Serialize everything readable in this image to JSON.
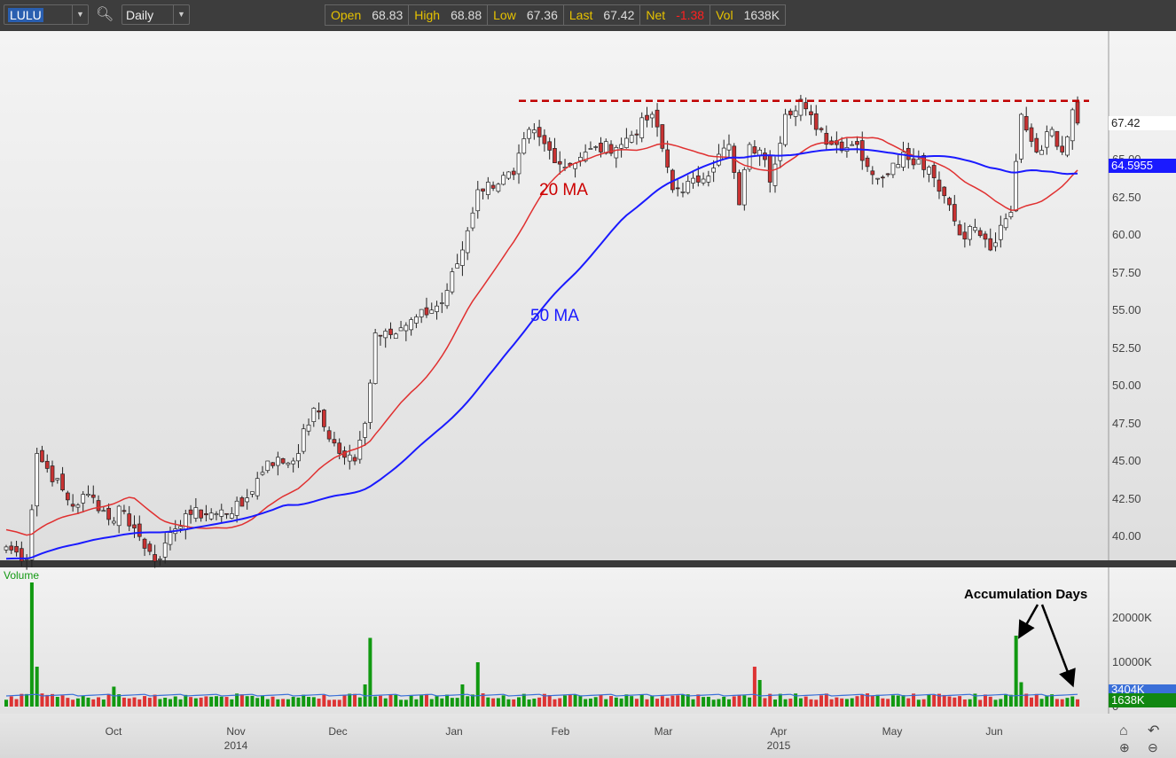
{
  "toolbar": {
    "symbol": "LULU",
    "interval": "Daily",
    "quote": [
      {
        "label": "Open",
        "value": "68.83"
      },
      {
        "label": "High",
        "value": "68.88"
      },
      {
        "label": "Low",
        "value": "67.36"
      },
      {
        "label": "Last",
        "value": "67.42"
      },
      {
        "label": "Net",
        "value": "-1.38"
      },
      {
        "label": "Vol",
        "value": "1638K"
      }
    ]
  },
  "price_axis": {
    "ticks": [
      "40.00",
      "42.50",
      "45.00",
      "47.50",
      "50.00",
      "52.50",
      "55.00",
      "57.50",
      "60.00",
      "62.50",
      "65.00"
    ],
    "last_tag": "67.42",
    "ma_tag": "64.5955"
  },
  "volume_axis": {
    "label": "Volume",
    "ticks": [
      "0",
      "10000K",
      "20000K"
    ],
    "avg_tag": "3404K",
    "last_tag": "1638K"
  },
  "x_axis": {
    "months": [
      "Oct",
      "Nov",
      "Dec",
      "Jan",
      "Feb",
      "Mar",
      "Apr",
      "May",
      "Jun"
    ],
    "years": [
      "2014",
      "2015"
    ]
  },
  "annotations": {
    "ma20": "20 MA",
    "ma50": "50 MA",
    "accumulation": "Accumulation Days"
  },
  "colors": {
    "up": "#ffffff",
    "down": "#c83232",
    "ma20": "#e03030",
    "ma50": "#1a1aff",
    "vol_up": "#119911",
    "vol_down": "#dd3333",
    "resistance": "#c00000"
  },
  "chart_data": {
    "type": "candlestick",
    "resistance": 68.9,
    "anchors": [
      [
        0,
        39.3
      ],
      [
        4,
        38.5
      ],
      [
        6,
        45.5
      ],
      [
        13,
        42
      ],
      [
        16,
        42.8
      ],
      [
        21,
        41
      ],
      [
        22,
        42
      ],
      [
        28,
        39
      ],
      [
        30,
        38.5
      ],
      [
        33,
        40.5
      ],
      [
        35,
        41.5
      ],
      [
        41,
        41.5
      ],
      [
        46,
        42
      ],
      [
        51,
        45
      ],
      [
        56,
        45
      ],
      [
        60,
        48.5
      ],
      [
        65,
        45.5
      ],
      [
        68,
        45
      ],
      [
        70,
        47.5
      ],
      [
        72,
        53.5
      ],
      [
        78,
        54
      ],
      [
        85,
        55.5
      ],
      [
        89,
        59
      ],
      [
        92,
        63
      ],
      [
        99,
        64
      ],
      [
        102,
        67
      ],
      [
        109,
        64.5
      ],
      [
        113,
        65.5
      ],
      [
        120,
        66
      ],
      [
        126,
        68
      ],
      [
        129,
        64.5
      ],
      [
        130,
        63
      ],
      [
        135,
        63.5
      ],
      [
        141,
        66
      ],
      [
        143,
        62
      ],
      [
        145,
        66
      ],
      [
        148,
        65
      ],
      [
        149,
        63.5
      ],
      [
        152,
        68
      ],
      [
        155,
        69
      ],
      [
        158,
        67
      ],
      [
        161,
        66
      ],
      [
        166,
        66
      ],
      [
        169,
        64
      ],
      [
        172,
        64
      ],
      [
        175,
        65.5
      ],
      [
        180,
        64.5
      ],
      [
        184,
        62
      ],
      [
        186,
        60
      ],
      [
        189,
        60.5
      ],
      [
        192,
        59
      ],
      [
        196,
        61.5
      ],
      [
        198,
        68
      ],
      [
        201,
        65.5
      ],
      [
        204,
        67
      ],
      [
        206,
        65.5
      ],
      [
        208,
        68.3
      ],
      [
        209,
        67.42
      ]
    ],
    "volume_spikes": [
      [
        5,
        28000
      ],
      [
        6,
        9000
      ],
      [
        21,
        4500
      ],
      [
        71,
        15500
      ],
      [
        70,
        5000
      ],
      [
        92,
        10000
      ],
      [
        89,
        5000
      ],
      [
        146,
        9000
      ],
      [
        147,
        6000
      ],
      [
        197,
        16000
      ],
      [
        198,
        5500
      ],
      [
        209,
        4500
      ]
    ]
  }
}
